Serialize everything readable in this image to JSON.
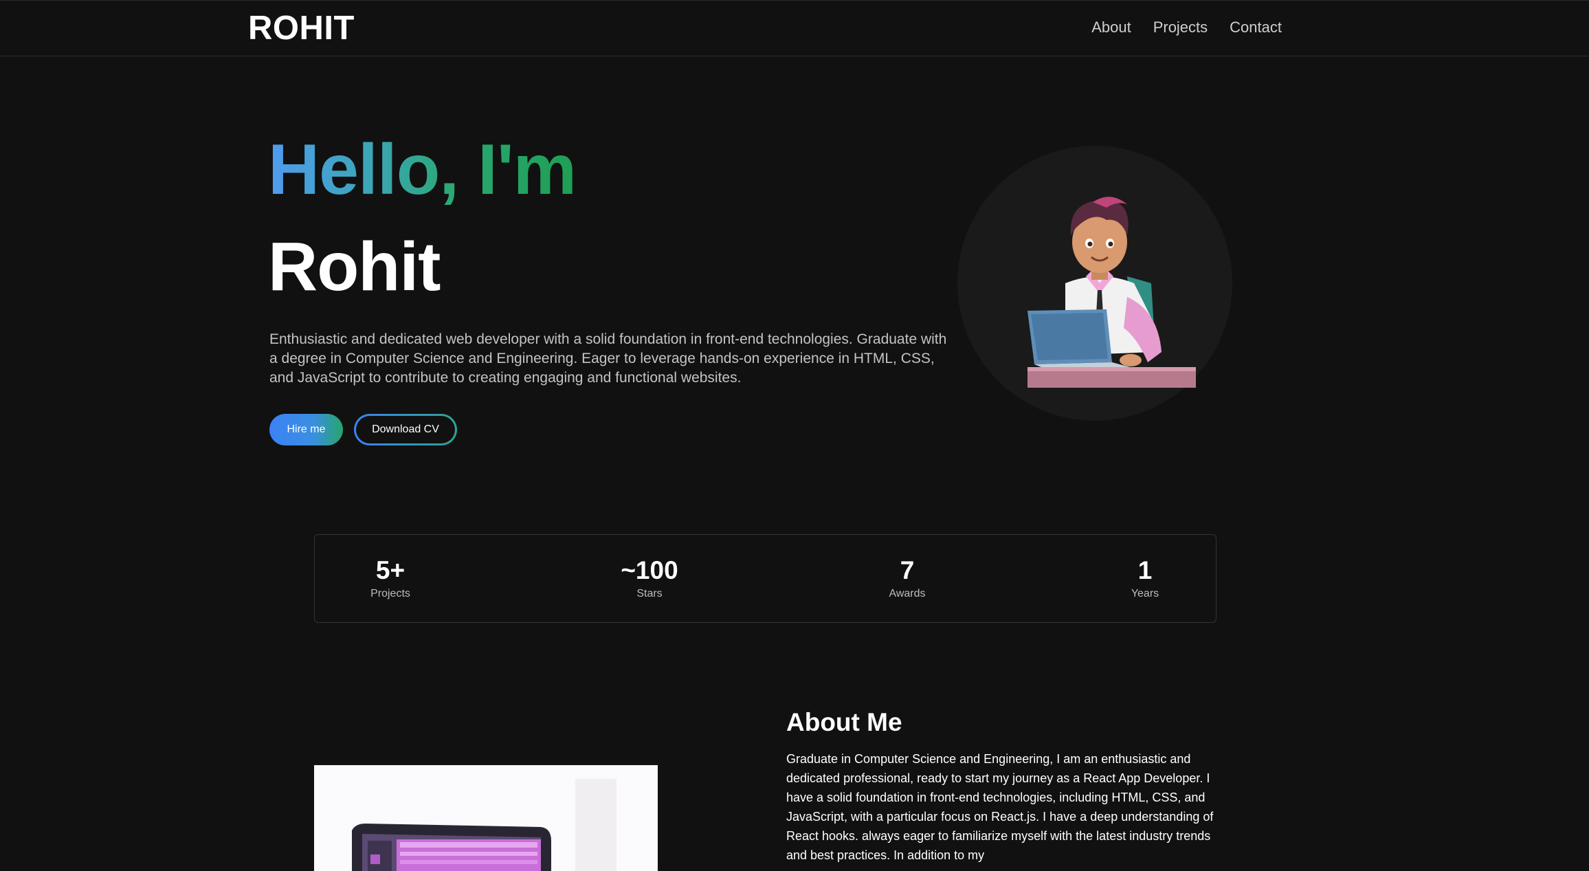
{
  "nav": {
    "brand": "ROHIT",
    "links": [
      "About",
      "Projects",
      "Contact"
    ]
  },
  "hero": {
    "greeting": "Hello, I'm",
    "name": "Rohit",
    "description": "Enthusiastic and dedicated web developer with a solid foundation in front-end technologies. Graduate with a degree in Computer Science and Engineering. Eager to leverage hands-on experience in HTML, CSS, and JavaScript to contribute to creating engaging and functional websites.",
    "hire_label": "Hire me",
    "cv_label": "Download CV"
  },
  "stats": [
    {
      "value": "5+",
      "label": "Projects"
    },
    {
      "value": "~100",
      "label": "Stars"
    },
    {
      "value": "7",
      "label": "Awards"
    },
    {
      "value": "1",
      "label": "Years"
    }
  ],
  "about": {
    "title": "About Me",
    "text": "Graduate in Computer Science and Engineering, I am an enthusiastic and dedicated professional, ready to start my journey as a React App Developer. I have a solid foundation in front-end technologies, including HTML, CSS, and JavaScript, with a particular focus on React.js. I have a deep understanding of React hooks. always eager to familiarize myself with the latest industry trends and best practices. In addition to my"
  },
  "colors": {
    "background": "#111111",
    "accent_blue": "#3b82f6",
    "accent_green": "#1f9e54"
  }
}
